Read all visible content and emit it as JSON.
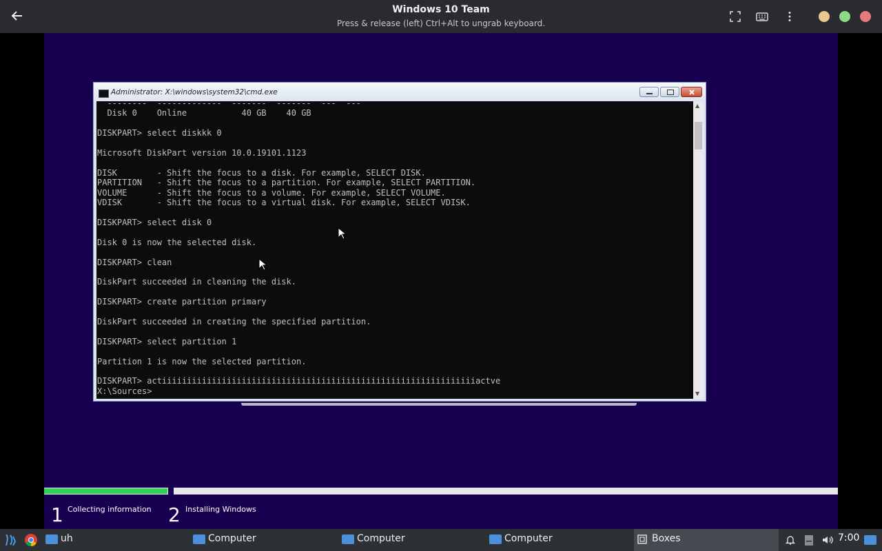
{
  "header": {
    "title": "Windows 10 Team",
    "subtitle": "Press & release (left) Ctrl+Alt to ungrab keyboard."
  },
  "cmd": {
    "title": "Administrator: X:\\windows\\system32\\cmd.exe",
    "lines": [
      "  --------  -------------  -------  -------  ---  ---",
      "  Disk 0    Online           40 GB    40 GB",
      "",
      "DISKPART> select diskkk 0",
      "",
      "Microsoft DiskPart version 10.0.19101.1123",
      "",
      "DISK        - Shift the focus to a disk. For example, SELECT DISK.",
      "PARTITION   - Shift the focus to a partition. For example, SELECT PARTITION.",
      "VOLUME      - Shift the focus to a volume. For example, SELECT VOLUME.",
      "VDISK       - Shift the focus to a virtual disk. For example, SELECT VDISK.",
      "",
      "DISKPART> select disk 0",
      "",
      "Disk 0 is now the selected disk.",
      "",
      "DISKPART> clean",
      "",
      "DiskPart succeeded in cleaning the disk.",
      "",
      "DISKPART> create partition primary",
      "",
      "DiskPart succeeded in creating the specified partition.",
      "",
      "DISKPART> select partition 1",
      "",
      "Partition 1 is now the selected partition.",
      "",
      "DISKPART> actiiiiiiiiiiiiiiiiiiiiiiiiiiiiiiiiiiiiiiiiiiiiiiiiiiiiiiiiiiiiiiiactve",
      "X:\\Sources>"
    ]
  },
  "setup": {
    "steps": [
      {
        "num": "1",
        "label": "Collecting information"
      },
      {
        "num": "2",
        "label": "Installing Windows"
      }
    ],
    "progress_fraction": 0.155
  },
  "taskbar": {
    "items": [
      {
        "label": "uh",
        "icon": "folder-icon"
      },
      {
        "label": "Computer",
        "icon": "folder-icon"
      },
      {
        "label": "Computer",
        "icon": "folder-icon"
      },
      {
        "label": "Computer",
        "icon": "folder-icon"
      },
      {
        "label": "Boxes",
        "icon": "boxes-icon"
      }
    ],
    "clock": "7:00"
  },
  "colors": {
    "vm_background": "#180050",
    "progress_done": "#2fd158",
    "dot_yellow": "#e8c88f",
    "dot_green": "#8fd88a",
    "dot_red": "#e8787e"
  }
}
